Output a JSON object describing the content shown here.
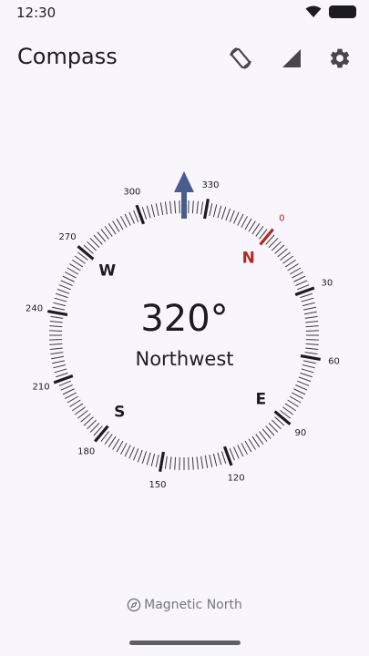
{
  "status": {
    "time": "12:30"
  },
  "app": {
    "title": "Compass"
  },
  "compass": {
    "heading_text": "320°",
    "direction": "Northwest",
    "heading_value": 320,
    "north_color": "#b3261e",
    "arrow_color": "#4a5c8c",
    "cardinals": [
      {
        "label": "N",
        "bearing": 0
      },
      {
        "label": "E",
        "bearing": 90
      },
      {
        "label": "S",
        "bearing": 180
      },
      {
        "label": "W",
        "bearing": 270
      }
    ],
    "degree_labels": [
      "0",
      "30",
      "60",
      "90",
      "120",
      "150",
      "180",
      "210",
      "240",
      "270",
      "300",
      "330"
    ]
  },
  "footer": {
    "mode_label": "Magnetic North",
    "icon": "compass-icon"
  },
  "icons": [
    "screen-rotation-icon",
    "signal-icon",
    "gear-icon",
    "wifi-icon",
    "battery-icon"
  ]
}
